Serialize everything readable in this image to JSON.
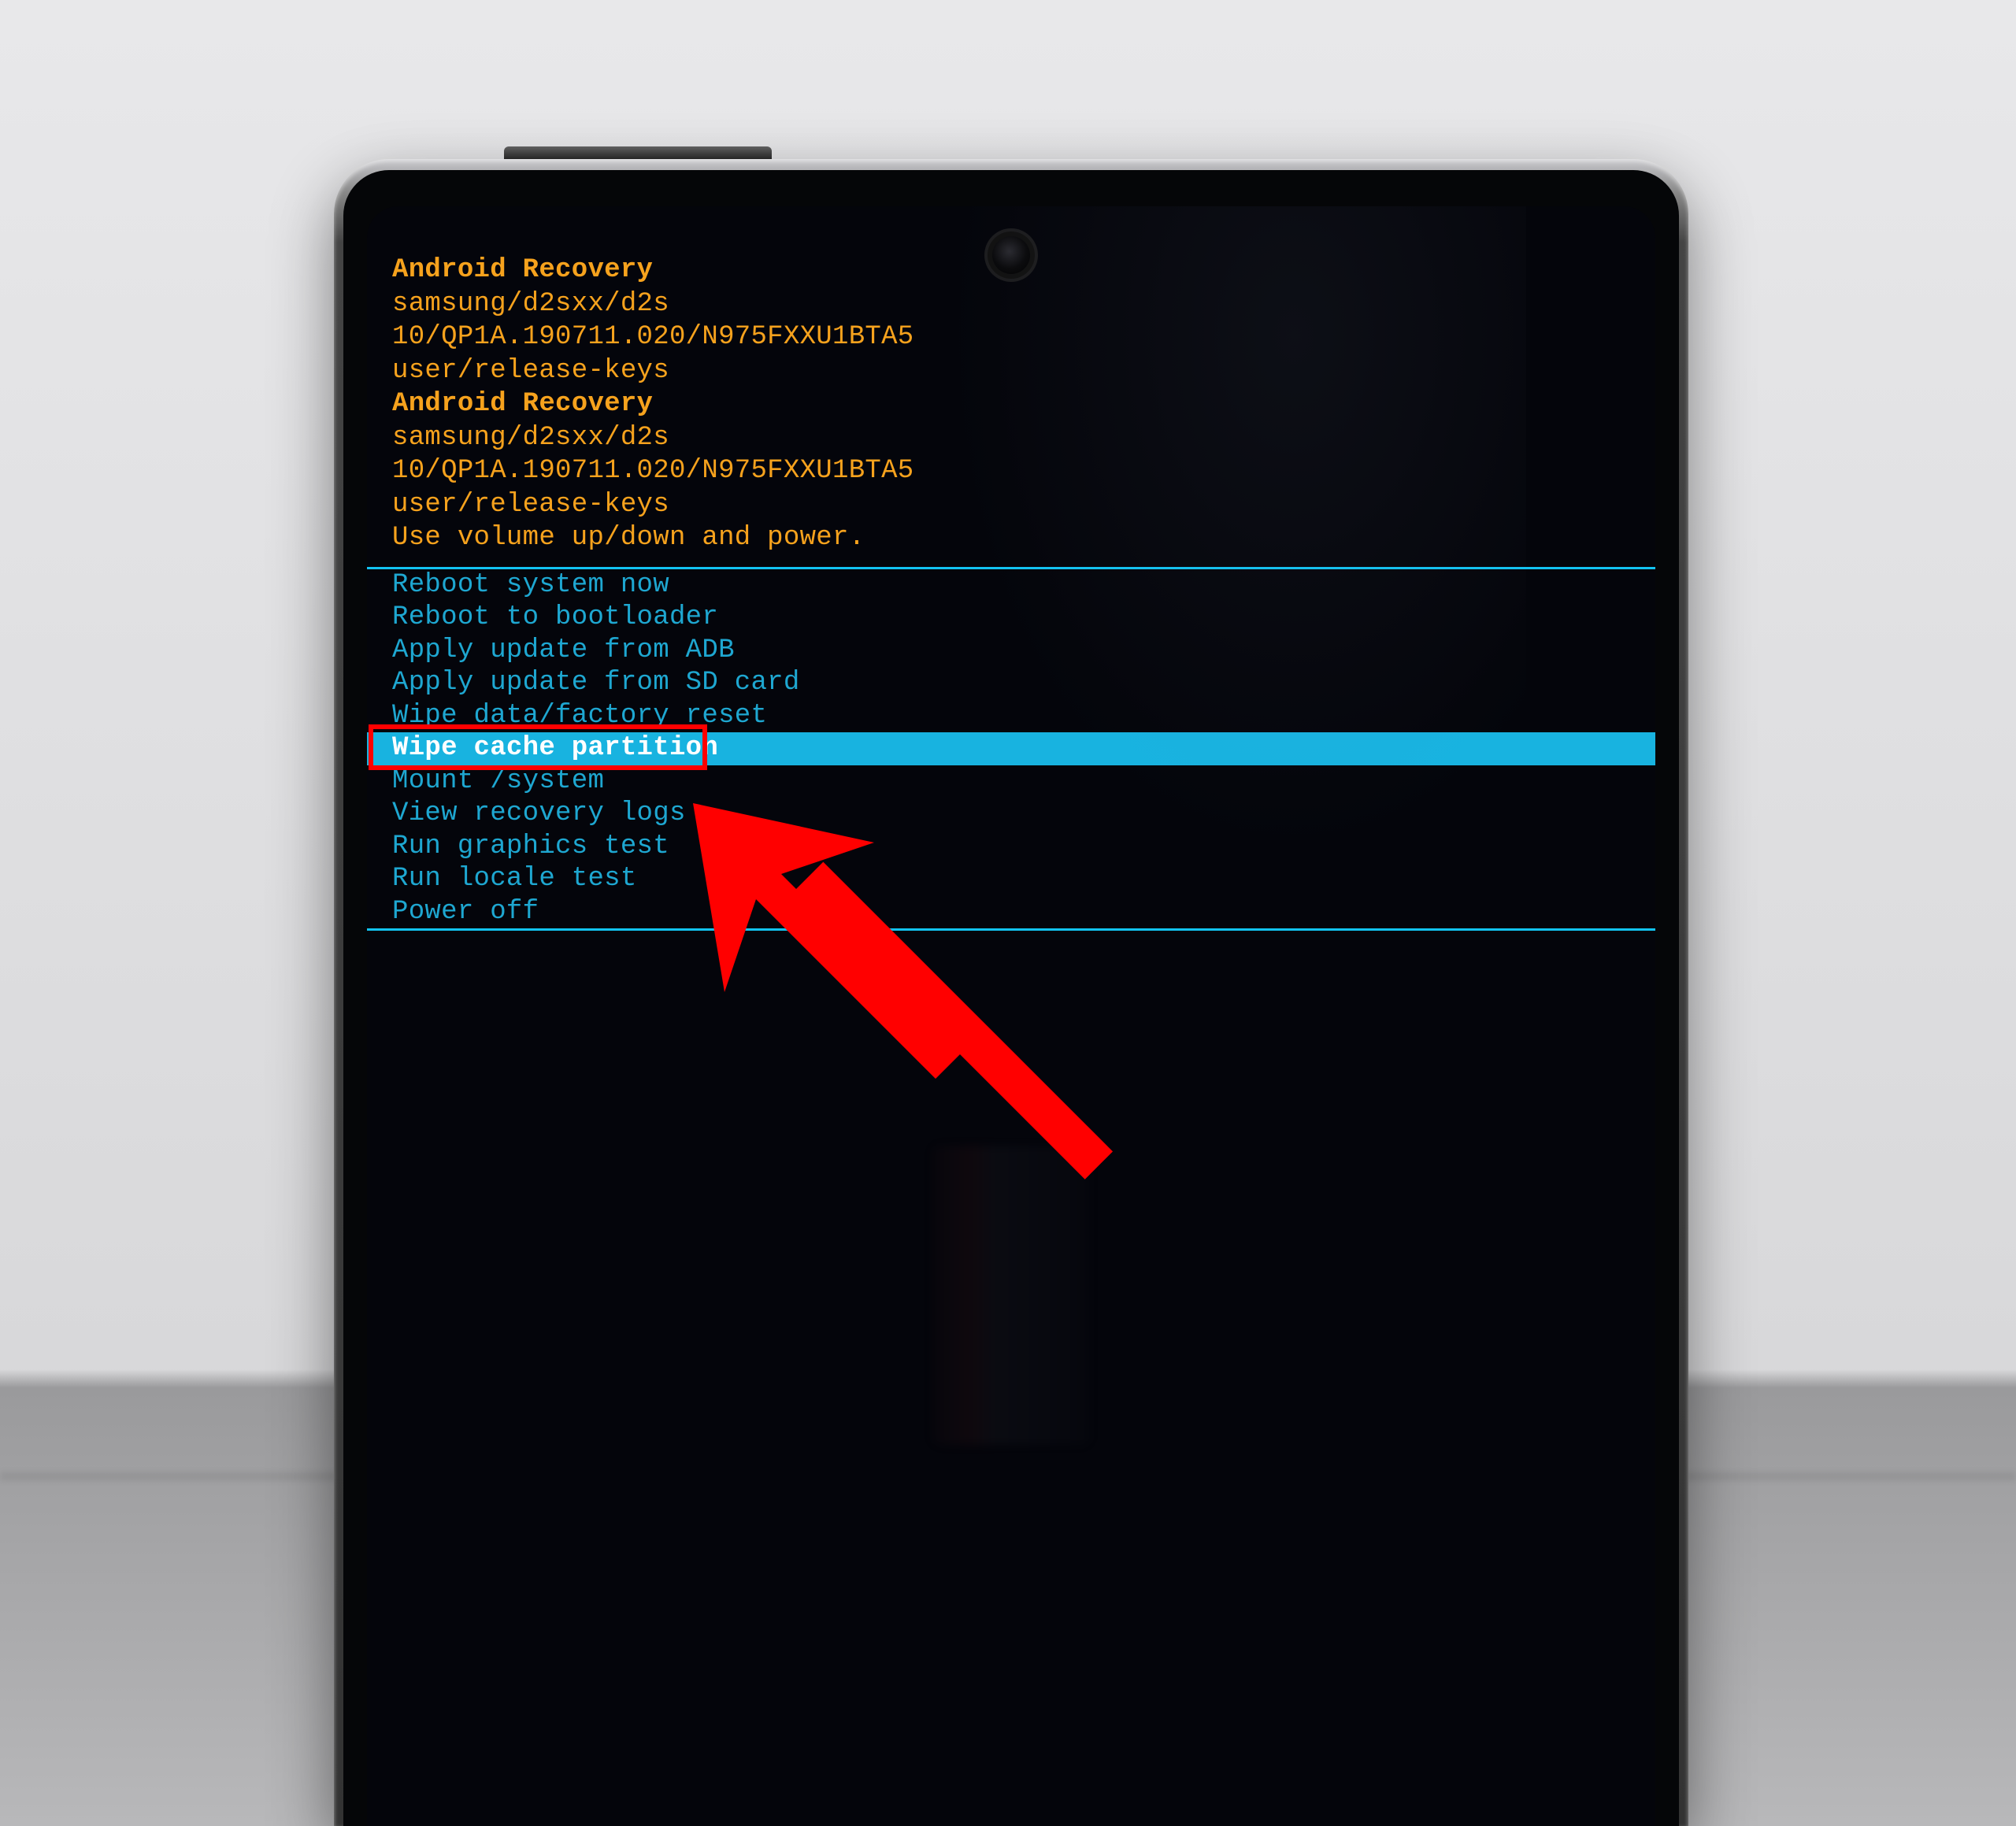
{
  "header": {
    "title1": "Android Recovery",
    "device1": "samsung/d2sxx/d2s",
    "build1": "10/QP1A.190711.020/N975FXXU1BTA5",
    "keys1": "user/release-keys",
    "title2": "Android Recovery",
    "device2": "samsung/d2sxx/d2s",
    "build2": "10/QP1A.190711.020/N975FXXU1BTA5",
    "keys2": "user/release-keys",
    "hint": "Use volume up/down and power."
  },
  "menu": {
    "items": [
      {
        "label": "Reboot system now",
        "selected": false
      },
      {
        "label": "Reboot to bootloader",
        "selected": false
      },
      {
        "label": "Apply update from ADB",
        "selected": false
      },
      {
        "label": "Apply update from SD card",
        "selected": false
      },
      {
        "label": "Wipe data/factory reset",
        "selected": false
      },
      {
        "label": "Wipe cache partition",
        "selected": true
      },
      {
        "label": "Mount /system",
        "selected": false
      },
      {
        "label": "View recovery logs",
        "selected": false
      },
      {
        "label": "Run graphics test",
        "selected": false
      },
      {
        "label": "Run locale test",
        "selected": false
      },
      {
        "label": "Power off",
        "selected": false
      }
    ]
  },
  "annotation": {
    "highlight_target": "Wipe cache partition",
    "arrow_color": "#ff0000",
    "box_color": "#ff0000"
  },
  "colors": {
    "header_text": "#f6a21d",
    "menu_text": "#1ea7d1",
    "menu_selected_bg": "#18b3e0",
    "menu_selected_text": "#ffffff",
    "divider": "#12c3f2"
  }
}
